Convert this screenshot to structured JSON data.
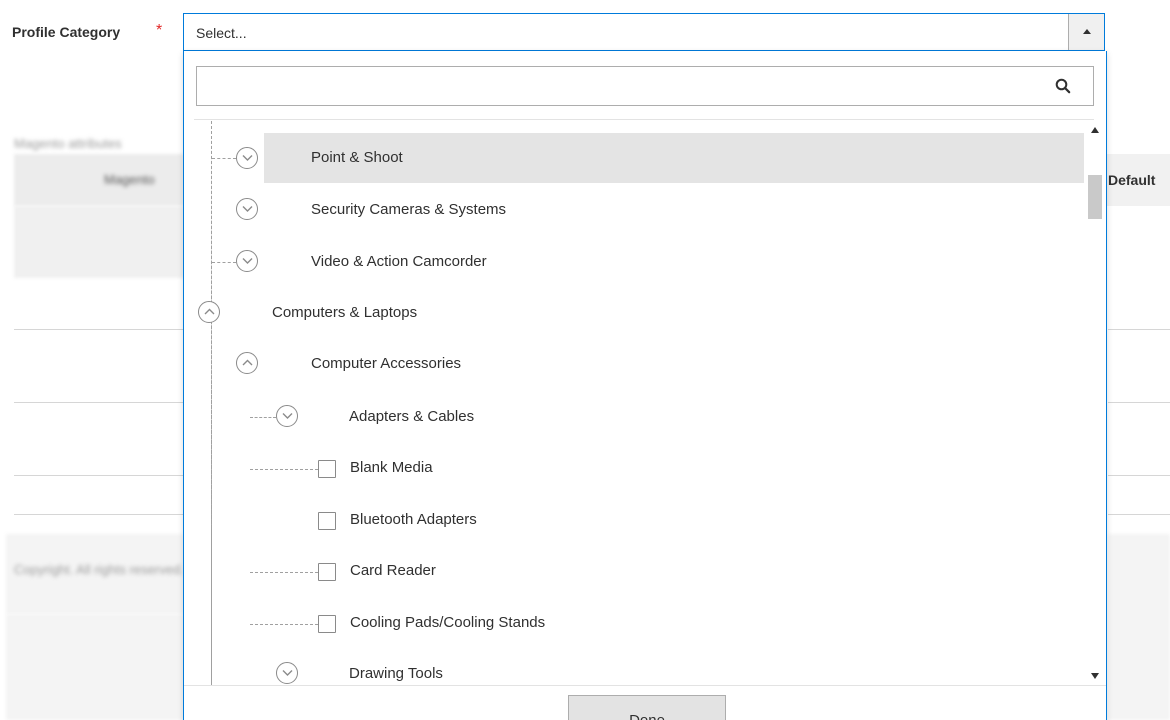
{
  "field": {
    "label": "Profile Category",
    "required_marker": "*",
    "selected_text": "Select..."
  },
  "dropdown": {
    "search_value": "",
    "items": [
      {
        "label": "Point & Shoot",
        "level": 2,
        "control": "expand",
        "highlighted": true
      },
      {
        "label": "Security Cameras & Systems",
        "level": 2,
        "control": "expand",
        "highlighted": false
      },
      {
        "label": "Video & Action Camcorder",
        "level": 2,
        "control": "expand",
        "highlighted": false
      },
      {
        "label": "Computers & Laptops",
        "level": 1,
        "control": "collapse",
        "highlighted": false
      },
      {
        "label": "Computer Accessories",
        "level": 2,
        "control": "collapse",
        "highlighted": false
      },
      {
        "label": "Adapters & Cables",
        "level": 3,
        "control": "expand",
        "highlighted": false
      },
      {
        "label": "Blank Media",
        "level": 3,
        "control": "checkbox",
        "highlighted": false
      },
      {
        "label": "Bluetooth Adapters",
        "level": 3,
        "control": "checkbox",
        "highlighted": false
      },
      {
        "label": "Card Reader",
        "level": 3,
        "control": "checkbox",
        "highlighted": false
      },
      {
        "label": "Cooling Pads/Cooling Stands",
        "level": 3,
        "control": "checkbox",
        "highlighted": false
      },
      {
        "label": "Drawing Tools",
        "level": 3,
        "control": "expand",
        "highlighted": false
      }
    ],
    "done_label": "Done"
  },
  "background": {
    "default_column_header": "Default"
  },
  "colors": {
    "focus_border": "#007bdb",
    "required": "#e22626",
    "highlight_row": "#e4e4e4"
  },
  "icons": {
    "search": "search-icon",
    "expand": "chevron-down-circle-icon",
    "collapse": "chevron-up-circle-icon",
    "dropdown_toggle": "triangle-up-icon"
  }
}
